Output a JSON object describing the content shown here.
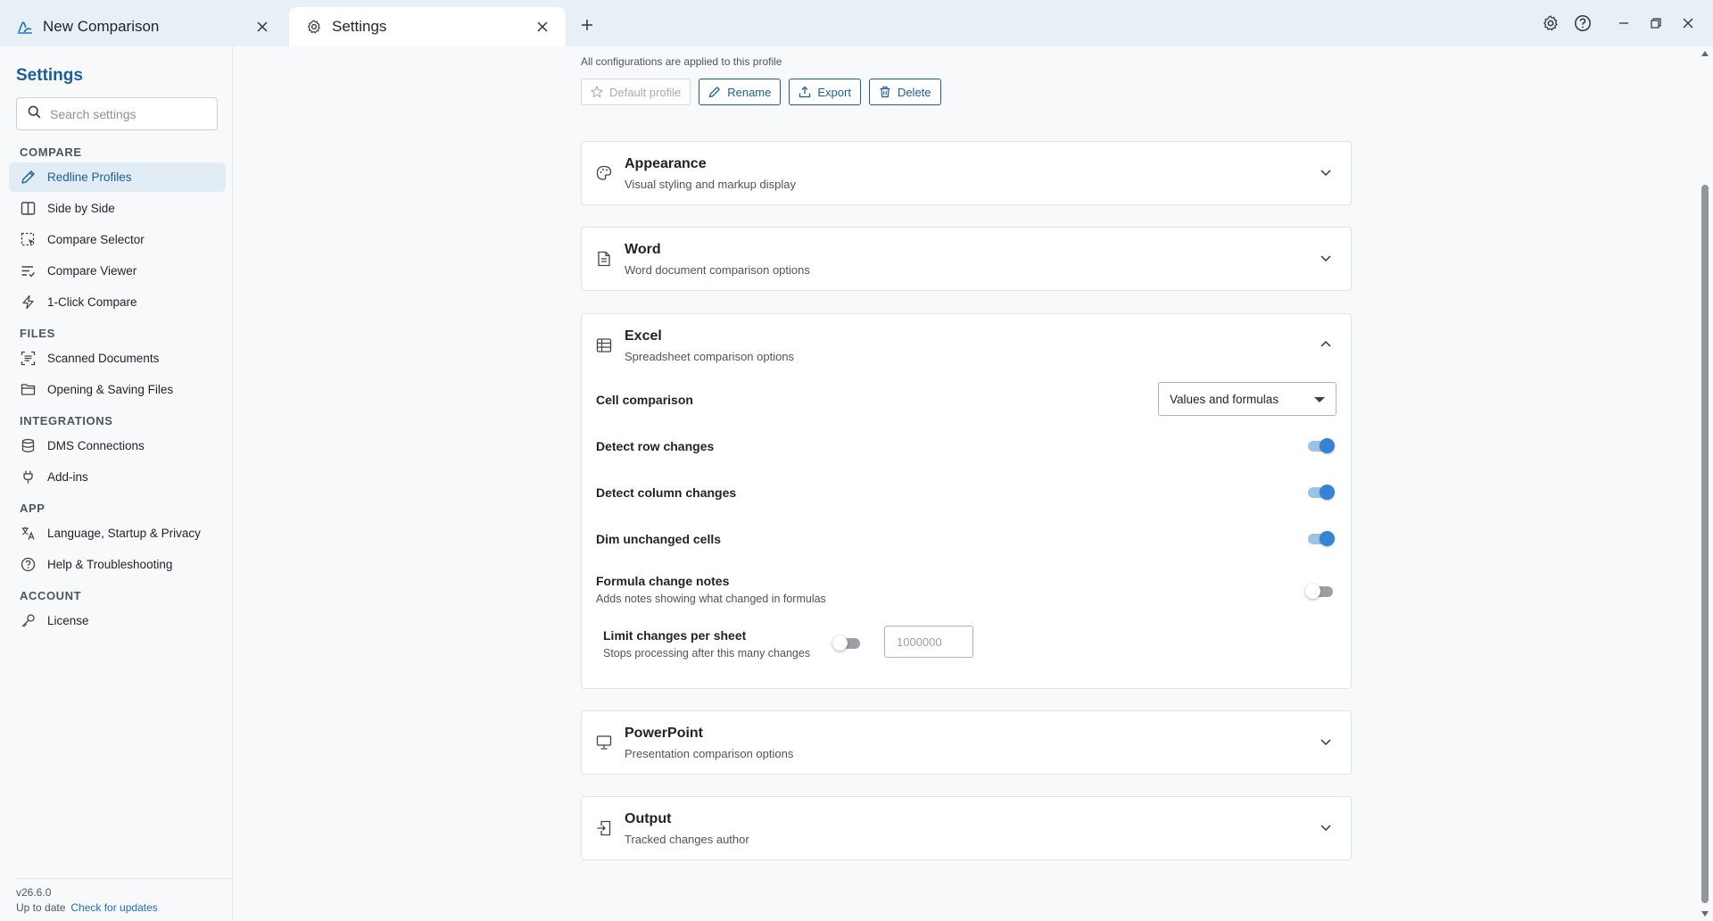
{
  "tabs": [
    {
      "label": "New Comparison",
      "icon": "compare-icon"
    },
    {
      "label": "Settings",
      "icon": "gear-icon"
    }
  ],
  "sidebar": {
    "title": "Settings",
    "search_placeholder": "Search settings",
    "sections": [
      {
        "label": "COMPARE",
        "items": [
          {
            "label": "Redline Profiles",
            "icon": "pencil-icon",
            "active": true
          },
          {
            "label": "Side by Side",
            "icon": "columns-icon"
          },
          {
            "label": "Compare Selector",
            "icon": "selection-icon"
          },
          {
            "label": "Compare Viewer",
            "icon": "list-check-icon"
          },
          {
            "label": "1-Click Compare",
            "icon": "lightning-icon"
          }
        ]
      },
      {
        "label": "FILES",
        "items": [
          {
            "label": "Scanned Documents",
            "icon": "scan-icon"
          },
          {
            "label": "Opening & Saving Files",
            "icon": "folder-icon"
          }
        ]
      },
      {
        "label": "INTEGRATIONS",
        "items": [
          {
            "label": "DMS Connections",
            "icon": "database-icon"
          },
          {
            "label": "Add-ins",
            "icon": "plug-icon"
          }
        ]
      },
      {
        "label": "APP",
        "items": [
          {
            "label": "Language, Startup & Privacy",
            "icon": "translate-icon"
          },
          {
            "label": "Help & Troubleshooting",
            "icon": "help-icon"
          }
        ]
      },
      {
        "label": "ACCOUNT",
        "items": [
          {
            "label": "License",
            "icon": "key-icon"
          }
        ]
      }
    ],
    "footer": {
      "version": "v26.6.0",
      "status": "Up to date",
      "check_link": "Check for updates"
    }
  },
  "main": {
    "profile_note": "All configurations are applied to this profile",
    "actions": {
      "default_profile": "Default profile",
      "rename": "Rename",
      "export": "Export",
      "delete": "Delete"
    },
    "cards": {
      "appearance": {
        "title": "Appearance",
        "subtitle": "Visual styling and markup display",
        "icon": "palette-icon"
      },
      "word": {
        "title": "Word",
        "subtitle": "Word document comparison options",
        "icon": "document-icon"
      },
      "excel": {
        "title": "Excel",
        "subtitle": "Spreadsheet comparison options",
        "icon": "table-icon",
        "cell_comparison": {
          "label": "Cell comparison",
          "value": "Values and formulas"
        },
        "detect_rows": {
          "label": "Detect row changes",
          "on": true
        },
        "detect_columns": {
          "label": "Detect column changes",
          "on": true
        },
        "dim_cells": {
          "label": "Dim unchanged cells",
          "on": true
        },
        "formula_notes": {
          "label": "Formula change notes",
          "sub": "Adds notes showing what changed in formulas",
          "on": false
        },
        "limit": {
          "label": "Limit changes per sheet",
          "sub": "Stops processing after this many changes",
          "on": false,
          "placeholder": "1000000"
        }
      },
      "powerpoint": {
        "title": "PowerPoint",
        "subtitle": "Presentation comparison options",
        "icon": "presentation-icon"
      },
      "output": {
        "title": "Output",
        "subtitle": "Tracked changes author",
        "icon": "output-icon"
      }
    }
  },
  "colors": {
    "accent": "#1b5e99",
    "toggle_on": "#3583d1",
    "tabbar": "#e7f0f7"
  }
}
